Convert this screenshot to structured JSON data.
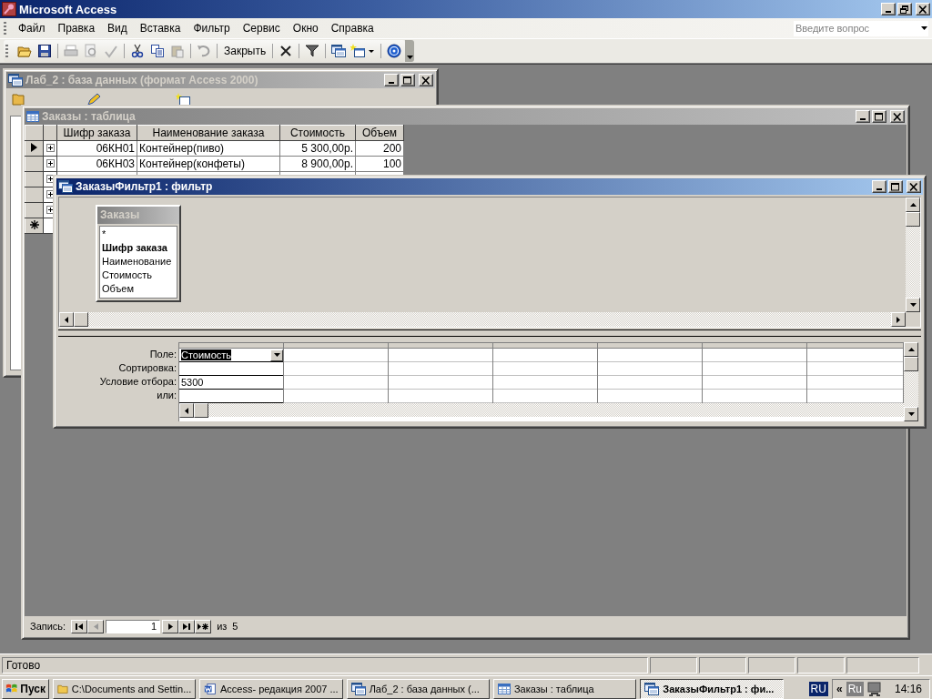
{
  "app_window": {
    "title": "Microsoft Access"
  },
  "menu": [
    {
      "label": "Файл"
    },
    {
      "label": "Правка"
    },
    {
      "label": "Вид"
    },
    {
      "label": "Вставка"
    },
    {
      "label": "Фильтр"
    },
    {
      "label": "Сервис"
    },
    {
      "label": "Окно"
    },
    {
      "label": "Справка"
    }
  ],
  "help_box": {
    "placeholder": "Введите вопрос"
  },
  "toolbar": {
    "close_label": "Закрыть"
  },
  "database_window": {
    "title": "Лаб_2 : база данных (формат Access 2000)",
    "active": false
  },
  "table_window": {
    "title": "Заказы : таблица",
    "active": false,
    "columns": [
      "Шифр заказа",
      "Наименование заказа",
      "Стоимость",
      "Объем"
    ],
    "rows": [
      {
        "current": true,
        "cells": [
          "06КН01",
          "Контейнер(пиво)",
          "5 300,00р.",
          "200"
        ]
      },
      {
        "current": false,
        "cells": [
          "06КН03",
          "Контейнер(конфеты)",
          "8 900,00р.",
          "100"
        ]
      },
      {
        "current": false
      },
      {
        "current": false
      },
      {
        "current": false
      }
    ],
    "record_nav": {
      "label": "Запись:",
      "current": "1",
      "of_label": "из",
      "total": "5"
    }
  },
  "filter_window": {
    "title": "ЗаказыФильтр1 : фильтр",
    "active": true,
    "field_list": {
      "title": "Заказы",
      "fields": [
        {
          "name": "*",
          "key": false
        },
        {
          "name": "Шифр заказа",
          "key": true
        },
        {
          "name": "Наименование",
          "key": false
        },
        {
          "name": "Стоимость",
          "key": false
        },
        {
          "name": "Объем",
          "key": false
        }
      ]
    },
    "row_labels": [
      "Поле:",
      "Сортировка:",
      "Условие отбора:",
      "или:"
    ],
    "grid_columns": [
      {
        "empty": false,
        "field": "Стоимость",
        "field_selected": true,
        "criteria": "5300"
      },
      {
        "empty": true
      },
      {
        "empty": true
      },
      {
        "empty": true
      },
      {
        "empty": true
      },
      {
        "empty": true
      },
      {
        "empty": true
      }
    ]
  },
  "status_bar": {
    "text": "Готово"
  },
  "taskbar": {
    "start": "Пуск",
    "tasks": [
      {
        "label": "C:\\Documents and Settin...",
        "selected": false
      },
      {
        "label": "Access- редакция 2007 ...",
        "selected": false
      },
      {
        "label": "Лаб_2 : база данных (...",
        "selected": false
      },
      {
        "label": "Заказы : таблица",
        "selected": false
      },
      {
        "label": "ЗаказыФильтр1 : фи...",
        "selected": true
      }
    ],
    "language": "RU",
    "tray_chevron": "«",
    "tray_language": "Ru",
    "clock": "14:16"
  }
}
